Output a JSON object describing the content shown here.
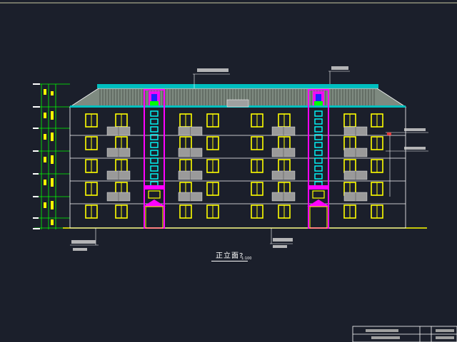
{
  "drawing": {
    "title": "正立面?",
    "scale": "1:100",
    "floors": 5,
    "window_columns": 8
  },
  "colors": {
    "background": "#1b1f2b",
    "outline": "#ffffff",
    "window": "#ffff00",
    "stair_frame": "#ff00ff",
    "stair_window": "#00ffff",
    "roof_eave": "#00bfbf",
    "dimension": "#00ff00",
    "balcony": "#9a9a9a",
    "annotation": "#ff3b3b"
  },
  "icons": {
    "roof": "hatched-roof-shape",
    "window": "yellow-rectangle-window",
    "balcony": "grey-balcony-rail",
    "stair": "magenta-stair-tower"
  }
}
